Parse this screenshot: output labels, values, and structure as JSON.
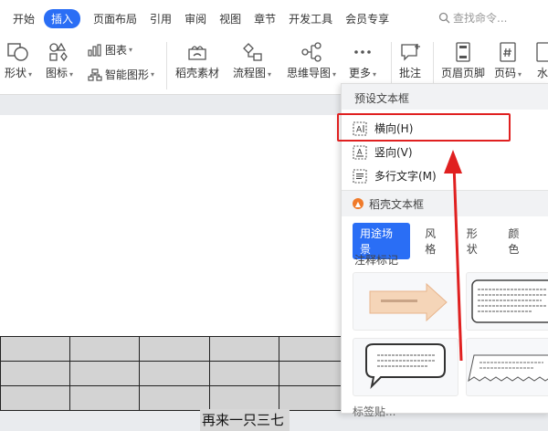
{
  "menubar": {
    "items": [
      "开始",
      "插入",
      "页面布局",
      "引用",
      "审阅",
      "视图",
      "章节",
      "开发工具",
      "会员专享"
    ],
    "active": "插入",
    "search_placeholder": "查找命令..."
  },
  "ribbon": {
    "shape": "形状",
    "icon": "图标",
    "chart": "图表",
    "smart_graphic": "智能图形",
    "material": "稻壳素材",
    "flowchart": "流程图",
    "mindmap": "思维导图",
    "more": "更多",
    "comment": "批注",
    "header_footer": "页眉页脚",
    "page_number": "页码",
    "watermark_partial": "水"
  },
  "document": {
    "selected_text": "再来一只三七"
  },
  "panel": {
    "preset_header": "预设文本框",
    "items": [
      {
        "label": "横向(H)",
        "highlighted": true
      },
      {
        "label": "竖向(V)",
        "highlighted": false
      },
      {
        "label": "多行文字(M)",
        "highlighted": false
      }
    ],
    "daoke_header": "稻壳文本框",
    "tabs": [
      "用途场景",
      "风格",
      "形状",
      "颜色"
    ],
    "active_tab": "用途场景",
    "section_label": "注释标记",
    "bottom_label": "标签贴..."
  },
  "colors": {
    "accent": "#2a6ef5",
    "highlight_red": "#e02020",
    "flame_orange": "#f07a2a"
  }
}
